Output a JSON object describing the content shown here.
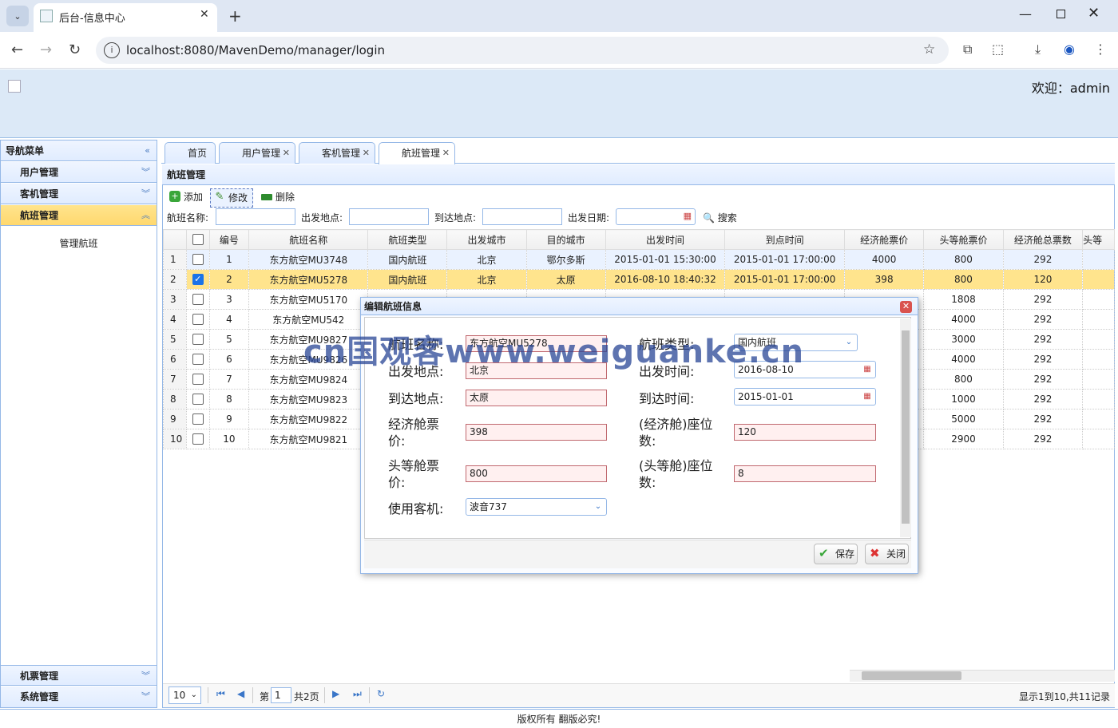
{
  "browser": {
    "tab_title": "后台-信息中心",
    "url": "localhost:8080/MavenDemo/manager/login"
  },
  "header": {
    "welcome": "欢迎：admin"
  },
  "sidebar": {
    "title": "导航菜单",
    "items": [
      "用户管理",
      "客机管理",
      "航班管理"
    ],
    "active_sub": "管理航班",
    "bottom_items": [
      "机票管理",
      "系统管理"
    ]
  },
  "tabs": [
    {
      "label": "首页",
      "closable": false
    },
    {
      "label": "用户管理",
      "closable": true
    },
    {
      "label": "客机管理",
      "closable": true
    },
    {
      "label": "航班管理",
      "closable": true,
      "active": true
    }
  ],
  "panel": {
    "title": "航班管理",
    "buttons": {
      "add": "添加",
      "edit": "修改",
      "delete": "删除"
    },
    "filters": {
      "name_label": "航班名称:",
      "from_label": "出发地点:",
      "to_label": "到达地点:",
      "date_label": "出发日期:",
      "search": "搜索"
    }
  },
  "grid": {
    "columns": [
      "编号",
      "航班名称",
      "航班类型",
      "出发城市",
      "目的城市",
      "出发时间",
      "到点时间",
      "经济舱票价",
      "头等舱票价",
      "经济舱总票数",
      "头等"
    ],
    "rows": [
      [
        "1",
        "东方航空MU3748",
        "国内航班",
        "北京",
        "鄂尔多斯",
        "2015-01-01 15:30:00",
        "2015-01-01 17:00:00",
        "4000",
        "800",
        "292",
        ""
      ],
      [
        "2",
        "东方航空MU5278",
        "国内航班",
        "北京",
        "太原",
        "2016-08-10 18:40:32",
        "2015-01-01 17:00:00",
        "398",
        "800",
        "120",
        ""
      ],
      [
        "3",
        "东方航空MU5170",
        "",
        "",
        "",
        "",
        "",
        "",
        "1808",
        "292",
        ""
      ],
      [
        "4",
        "东方航空MU542",
        "",
        "",
        "",
        "",
        "",
        "",
        "4000",
        "292",
        ""
      ],
      [
        "5",
        "东方航空MU9827",
        "",
        "",
        "",
        "",
        "",
        "",
        "3000",
        "292",
        ""
      ],
      [
        "6",
        "东方航空MU9826",
        "",
        "",
        "",
        "",
        "",
        "",
        "4000",
        "292",
        ""
      ],
      [
        "7",
        "东方航空MU9824",
        "",
        "",
        "",
        "",
        "",
        "",
        "800",
        "292",
        ""
      ],
      [
        "8",
        "东方航空MU9823",
        "",
        "",
        "",
        "",
        "",
        "",
        "1000",
        "292",
        ""
      ],
      [
        "9",
        "东方航空MU9822",
        "",
        "",
        "",
        "",
        "",
        "",
        "5000",
        "292",
        ""
      ],
      [
        "10",
        "东方航空MU9821",
        "",
        "",
        "",
        "",
        "",
        "",
        "2900",
        "292",
        ""
      ]
    ],
    "selected_row": 2,
    "hover_row": 1
  },
  "pager": {
    "page_size": "10",
    "page_prefix": "第",
    "page_value": "1",
    "page_total": "共2页",
    "summary": "显示1到10,共11记录"
  },
  "footer": "版权所有 翻版必究!",
  "dialog": {
    "title": "编辑航班信息",
    "labels": {
      "name": "航班名称:",
      "type": "航班类型:",
      "from": "出发地点:",
      "depart_time": "出发时间:",
      "to": "到达地点:",
      "arrive_time": "到达时间:",
      "eco_price_1": "经济舱票",
      "eco_price_2": "价:",
      "eco_seats_1": "(经济舱)座位",
      "eco_seats_2": "数:",
      "first_price_1": "头等舱票",
      "first_price_2": "价:",
      "first_seats_1": "(头等舱)座位",
      "first_seats_2": "数:",
      "plane": "使用客机:"
    },
    "values": {
      "name": "东方航空MU5278",
      "type": "国内航班",
      "from": "北京",
      "depart_time": "2016-08-10",
      "to": "太原",
      "arrive_time": "2015-01-01",
      "eco_price": "398",
      "eco_seats": "120",
      "first_price": "800",
      "first_seats": "8",
      "plane": "波音737"
    },
    "buttons": {
      "save": "保存",
      "close": "关闭"
    }
  },
  "watermark": "cn国观客www.weiguanke.cn"
}
